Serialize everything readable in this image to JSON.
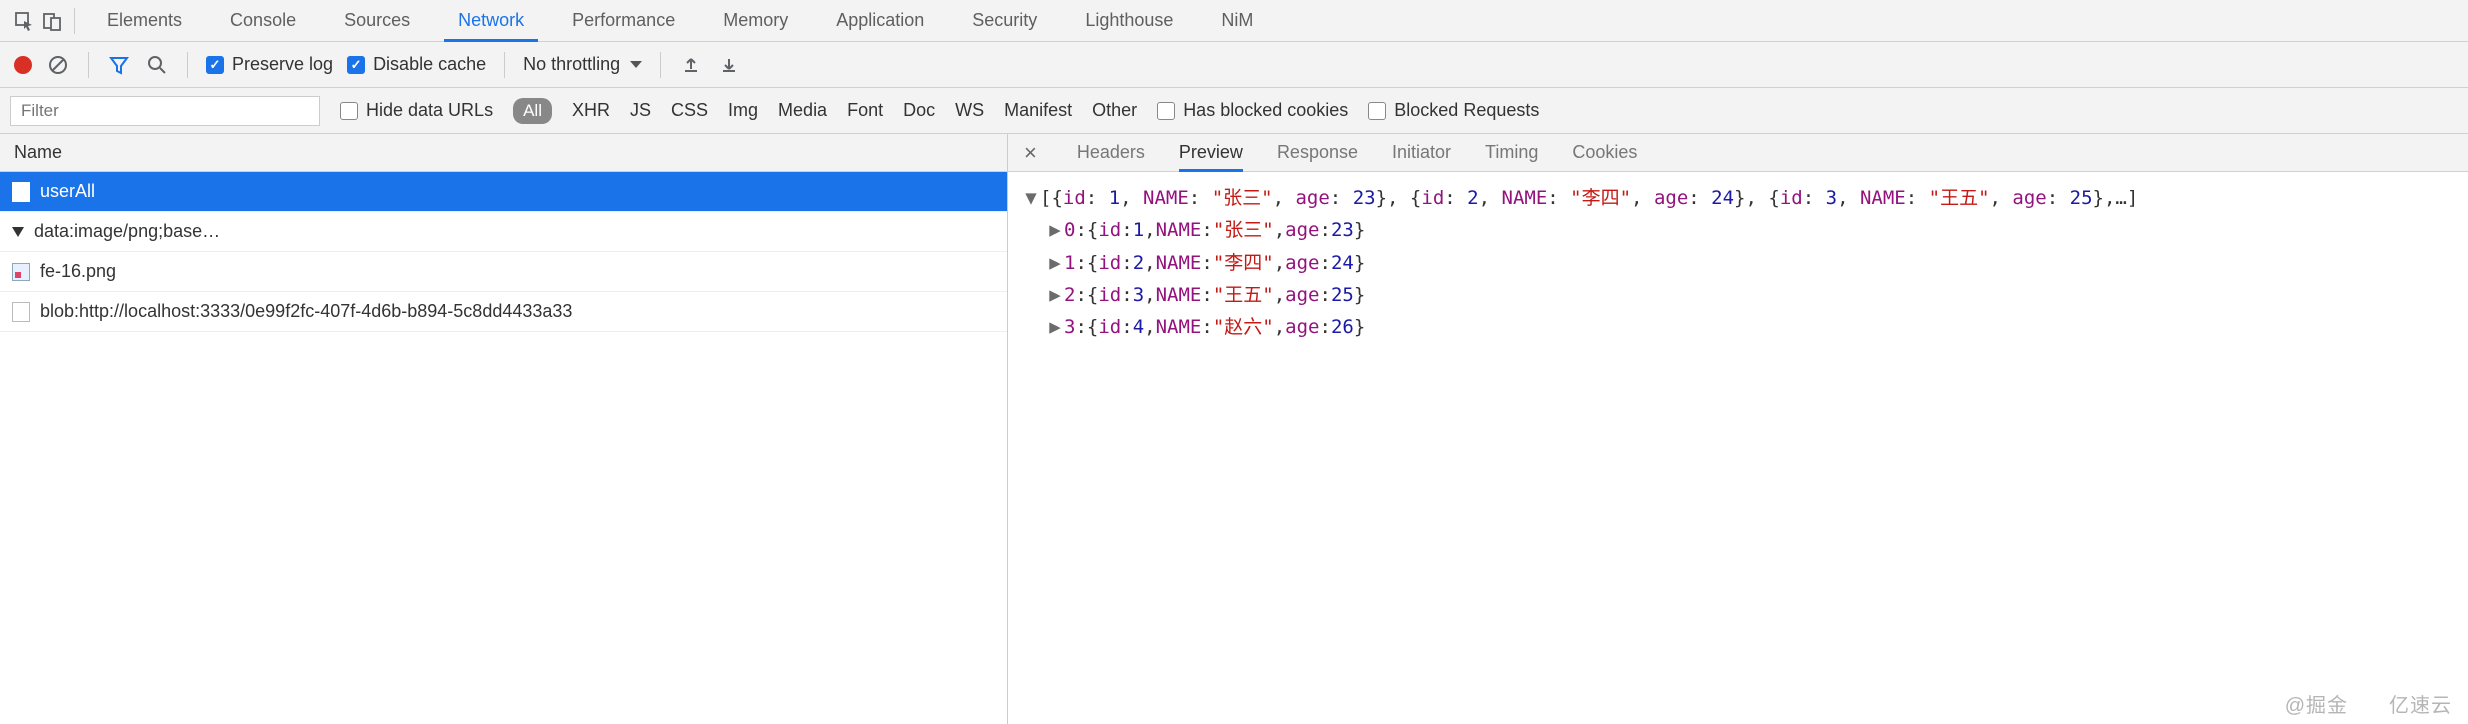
{
  "tabs": {
    "items": [
      "Elements",
      "Console",
      "Sources",
      "Network",
      "Performance",
      "Memory",
      "Application",
      "Security",
      "Lighthouse",
      "NiM"
    ],
    "active_index": 3
  },
  "toolbar": {
    "preserve_log_label": "Preserve log",
    "preserve_log_checked": true,
    "disable_cache_label": "Disable cache",
    "disable_cache_checked": true,
    "throttling_label": "No throttling"
  },
  "filter": {
    "placeholder": "Filter",
    "hide_data_urls_label": "Hide data URLs",
    "hide_data_urls_checked": false,
    "pill": "All",
    "types": [
      "XHR",
      "JS",
      "CSS",
      "Img",
      "Media",
      "Font",
      "Doc",
      "WS",
      "Manifest",
      "Other"
    ],
    "has_blocked_cookies_label": "Has blocked cookies",
    "has_blocked_cookies_checked": false,
    "blocked_requests_label": "Blocked Requests",
    "blocked_requests_checked": false
  },
  "name_header": "Name",
  "requests": [
    {
      "name": "userAll",
      "selected": true,
      "icon": "file"
    },
    {
      "name": "data:image/png;base…",
      "selected": false,
      "icon": "triangle"
    },
    {
      "name": "fe-16.png",
      "selected": false,
      "icon": "image"
    },
    {
      "name": "blob:http://localhost:3333/0e99f2fc-407f-4d6b-b894-5c8dd4433a33",
      "selected": false,
      "icon": "blank"
    }
  ],
  "detail_tabs": {
    "items": [
      "Headers",
      "Preview",
      "Response",
      "Initiator",
      "Timing",
      "Cookies"
    ],
    "active_index": 1
  },
  "preview_data": {
    "summary_prefix": "[{id: 1, NAME: \"张三\", age: 23}, {id: 2, NAME: \"李四\", age: 24}, {id: 3, NAME: \"王五\", age: 25},…]",
    "items": [
      {
        "index": 0,
        "id": 1,
        "NAME": "张三",
        "age": 23
      },
      {
        "index": 1,
        "id": 2,
        "NAME": "李四",
        "age": 24
      },
      {
        "index": 2,
        "id": 3,
        "NAME": "王五",
        "age": 25
      },
      {
        "index": 3,
        "id": 4,
        "NAME": "赵六",
        "age": 26
      }
    ]
  },
  "watermark1": "@掘金",
  "watermark2": "亿速云"
}
